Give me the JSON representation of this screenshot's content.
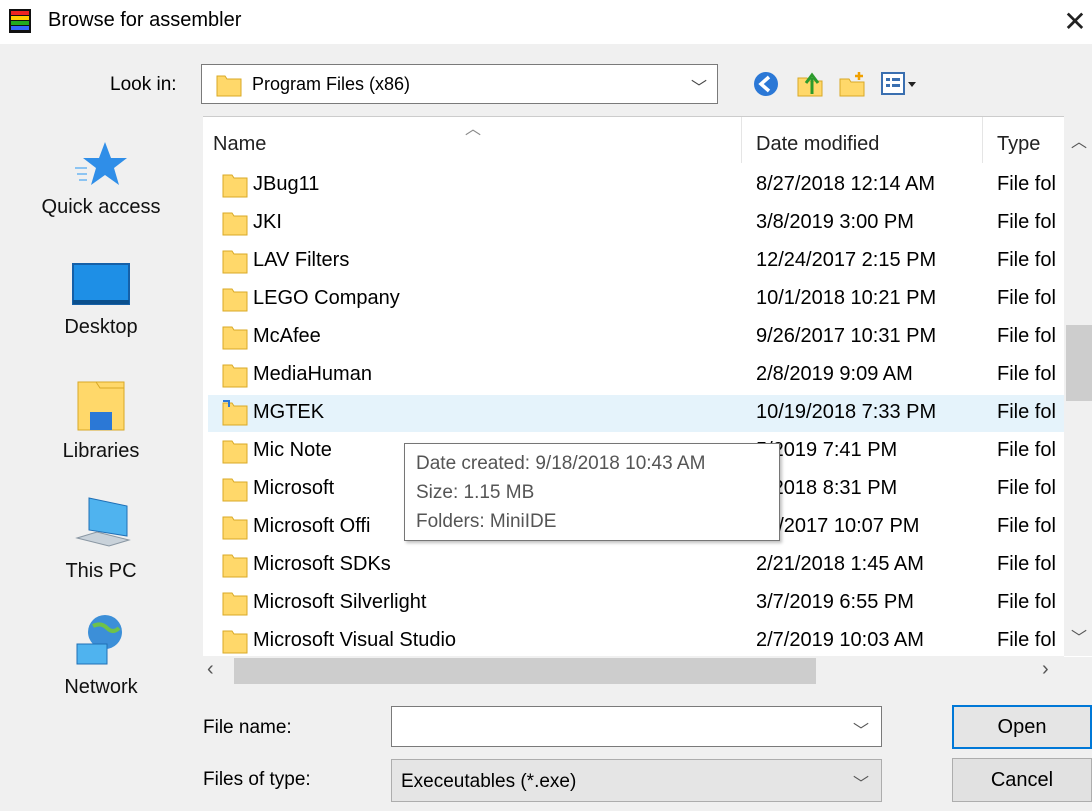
{
  "window": {
    "title": "Browse for assembler",
    "close_glyph": "✕"
  },
  "toolbar": {
    "look_in_label": "Look in:",
    "look_in_value": "Program Files (x86)",
    "buttons": [
      {
        "name": "back-icon"
      },
      {
        "name": "up-folder-icon"
      },
      {
        "name": "new-folder-icon"
      },
      {
        "name": "view-menu-icon"
      }
    ]
  },
  "places": [
    {
      "label": "Quick access",
      "icon": "star-icon"
    },
    {
      "label": "Desktop",
      "icon": "desktop-icon"
    },
    {
      "label": "Libraries",
      "icon": "libraries-icon"
    },
    {
      "label": "This PC",
      "icon": "computer-icon"
    },
    {
      "label": "Network",
      "icon": "network-icon"
    }
  ],
  "list": {
    "columns": [
      "Name",
      "Date modified",
      "Type"
    ],
    "rows": [
      {
        "name": "JBug11",
        "date": "8/27/2018 12:14 AM",
        "type": "File fol"
      },
      {
        "name": "JKI",
        "date": "3/8/2019 3:00 PM",
        "type": "File fol"
      },
      {
        "name": "LAV Filters",
        "date": "12/24/2017 2:15 PM",
        "type": "File fol"
      },
      {
        "name": "LEGO Company",
        "date": "10/1/2018 10:21 PM",
        "type": "File fol"
      },
      {
        "name": "McAfee",
        "date": "9/26/2017 10:31 PM",
        "type": "File fol"
      },
      {
        "name": "MediaHuman",
        "date": "2/8/2019 9:09 AM",
        "type": "File fol"
      },
      {
        "name": "MGTEK",
        "date": "10/19/2018 7:33 PM",
        "type": "File fol"
      },
      {
        "name": "Mic Note",
        "date": "5/2019 7:41 PM",
        "type": "File fol"
      },
      {
        "name": "Microsoft",
        "date": "4/2018 8:31 PM",
        "type": "File fol"
      },
      {
        "name": "Microsoft Offi",
        "date": "26/2017 10:07 PM",
        "type": "File fol"
      },
      {
        "name": "Microsoft SDKs",
        "date": "2/21/2018 1:45 AM",
        "type": "File fol"
      },
      {
        "name": "Microsoft Silverlight",
        "date": "3/7/2019 6:55 PM",
        "type": "File fol"
      },
      {
        "name": "Microsoft Visual Studio",
        "date": "2/7/2019 10:03 AM",
        "type": "File fol"
      }
    ]
  },
  "tooltip": {
    "created": "Date created: 9/18/2018 10:43 AM",
    "size": "Size: 1.15 MB",
    "folders": "Folders: MiniIDE"
  },
  "form": {
    "file_name_label": "File name:",
    "file_name_value": "",
    "files_of_type_label": "Files of type:",
    "files_of_type_value": "Execeutables (*.exe)"
  },
  "buttons": {
    "open": "Open",
    "cancel": "Cancel"
  },
  "colors": {
    "selection": "#e5f3fb",
    "focus_border": "#0078d7",
    "folder_yellow": "#ffd86a"
  }
}
